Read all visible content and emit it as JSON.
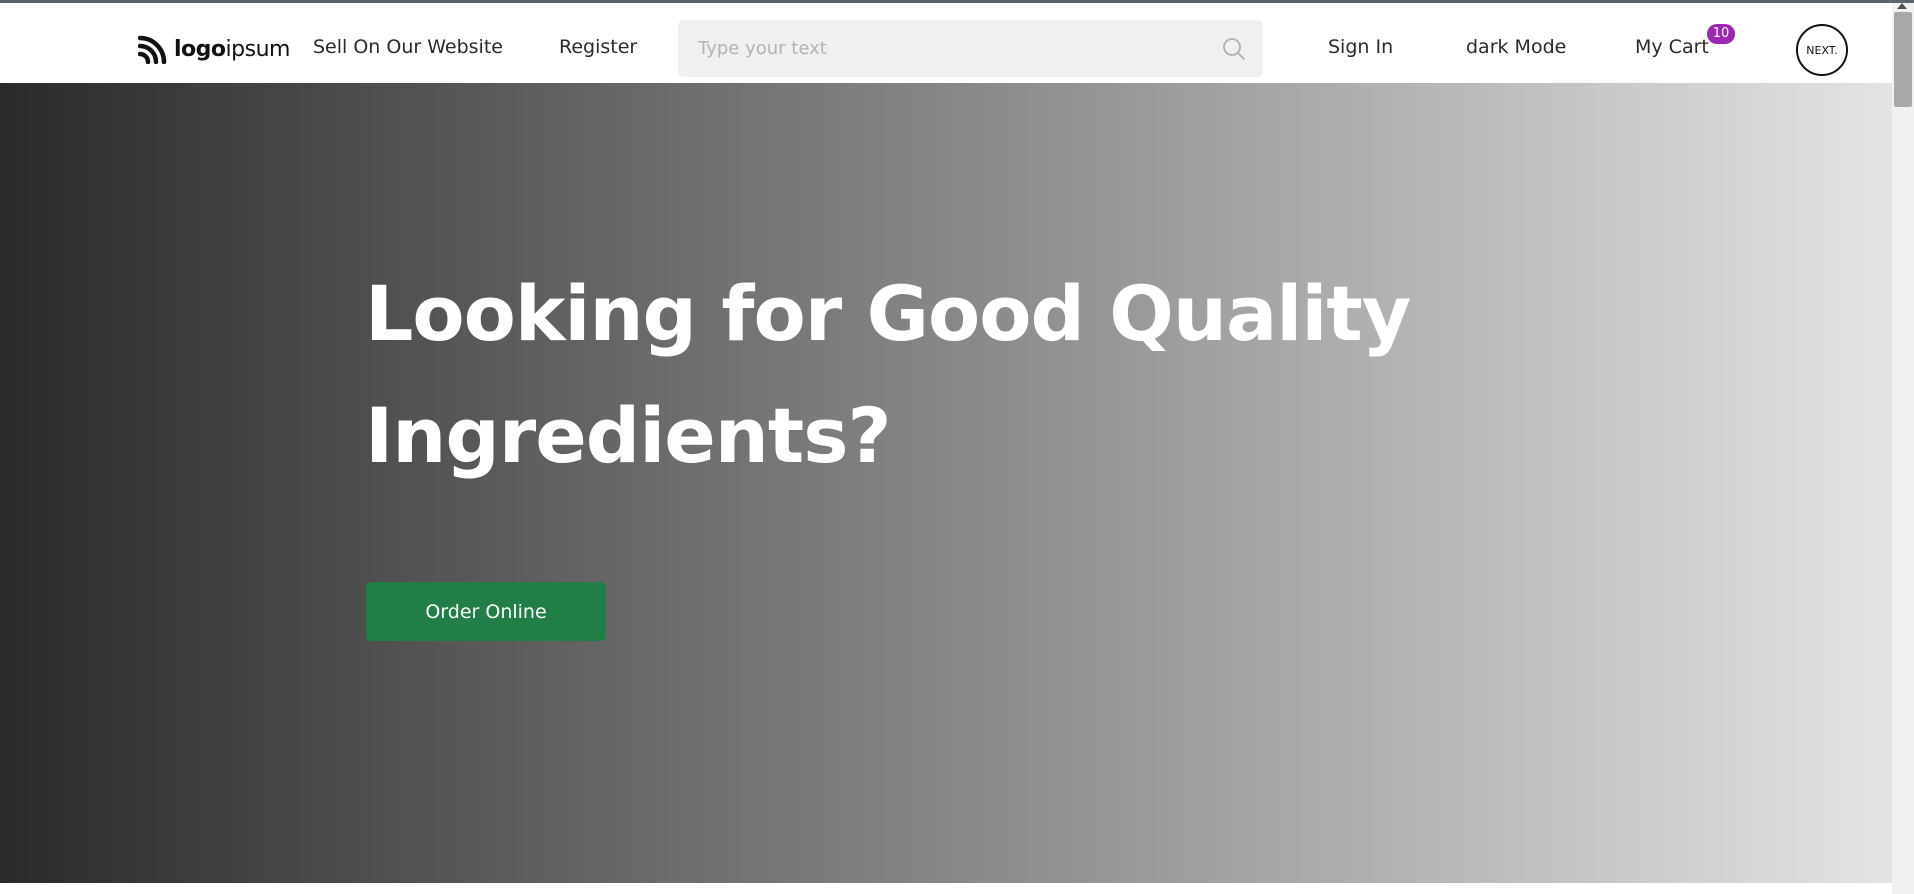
{
  "brand": {
    "logo_bold": "logo",
    "logo_regular": "ipsum",
    "logo_icon": "logoipsum-mark-icon"
  },
  "nav": {
    "sell_label": "Sell On Our Website",
    "register_label": "Register",
    "sign_in_label": "Sign In",
    "dark_mode_label": "dark Mode",
    "cart_label": "My Cart",
    "cart_count": "10",
    "avatar_text": "NEXT.",
    "avatar_icon": "nextjs-logo-icon"
  },
  "search": {
    "placeholder": "Type your text",
    "value": "",
    "icon": "search-icon"
  },
  "hero": {
    "title": "Looking for Good Quality Ingredients?",
    "button_label": "Order Online",
    "gradient_start": "#2a2a2a",
    "gradient_end": "#e4e4e4"
  },
  "colors": {
    "button_green": "#217e47",
    "badge_purple": "#9c27b0",
    "search_bg": "#f1eff0"
  }
}
